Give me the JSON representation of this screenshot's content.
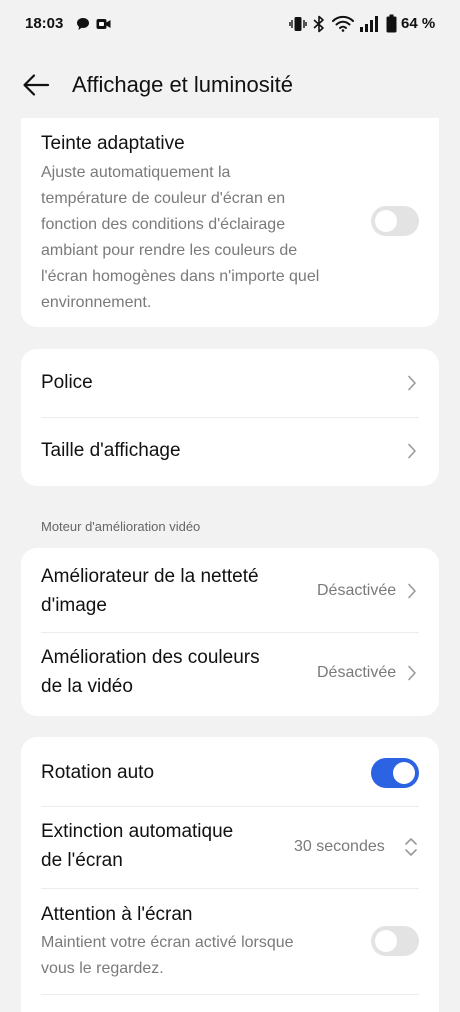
{
  "status_bar": {
    "time": "18:03",
    "battery": "64 %",
    "icons": [
      "chat-bubble-icon",
      "video-notification-icon",
      "vibrate-icon",
      "bluetooth-icon",
      "wifi-icon",
      "signal-icon",
      "battery-icon"
    ]
  },
  "app_bar": {
    "back_icon": "arrow-left-icon",
    "title": "Affichage et luminosité"
  },
  "adaptive_tint": {
    "title": "Teinte adaptative",
    "description_lines": [
      "Ajuste automatiquement la",
      "température de couleur d'écran en",
      "fonction des conditions d'éclairage",
      "ambiant pour rendre les couleurs de",
      "l'écran homogènes dans n'importe quel",
      "environnement."
    ],
    "enabled": false
  },
  "font_card": {
    "police": "Police",
    "display_size": "Taille d'affichage"
  },
  "video_section": {
    "header": "Moteur d'amélioration vidéo",
    "sharpness": {
      "title_lines": [
        "Améliorateur de la netteté",
        "d'image"
      ],
      "value": "Désactivée"
    },
    "colors": {
      "title_lines": [
        "Amélioration des couleurs",
        "de la vidéo"
      ],
      "value": "Désactivée"
    }
  },
  "screen_card": {
    "auto_rotation": {
      "title": "Rotation auto",
      "enabled": true
    },
    "auto_off": {
      "title_lines": [
        "Extinction automatique",
        "de l'écran"
      ],
      "value": "30 secondes"
    },
    "screen_attention": {
      "title": "Attention à l'écran",
      "description_lines": [
        "Maintient votre écran activé lorsque",
        "vous le regardez."
      ],
      "enabled": false
    }
  },
  "colors": {
    "accent": "#2b63e3",
    "toggle_off": "#e3e3e3",
    "background": "#f2f2f2",
    "card": "#ffffff"
  }
}
